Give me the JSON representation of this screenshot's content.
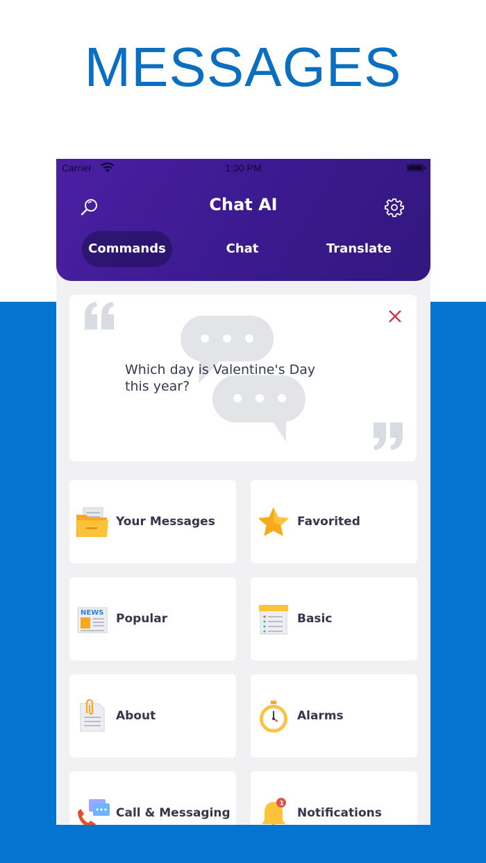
{
  "headline": "MESSAGES",
  "status_bar": {
    "carrier": "Carrier",
    "time": "1:30 PM"
  },
  "nav": {
    "title": "Chat AI",
    "left_icon": "search-icon",
    "right_icon": "gear-icon"
  },
  "tabs": [
    {
      "label": "Commands",
      "active": true
    },
    {
      "label": "Chat",
      "active": false
    },
    {
      "label": "Translate",
      "active": false
    }
  ],
  "quote_card": {
    "text": "Which day is Valentine's Day this year?",
    "close_icon": "close-icon"
  },
  "tiles": [
    {
      "label": "Your Messages",
      "icon": "folder-icon"
    },
    {
      "label": "Favorited",
      "icon": "star-icon"
    },
    {
      "label": "Popular",
      "icon": "news-icon"
    },
    {
      "label": "Basic",
      "icon": "notepad-icon"
    },
    {
      "label": "About",
      "icon": "document-clip-icon"
    },
    {
      "label": "Alarms",
      "icon": "stopwatch-icon"
    },
    {
      "label": "Call & Messaging",
      "icon": "phone-chat-icon"
    },
    {
      "label": "Notifications",
      "icon": "bell-icon",
      "badge": "1"
    }
  ],
  "colors": {
    "brand_blue": "#0474d1",
    "header_purple": "#3a1a8e",
    "close_red": "#d0344a"
  }
}
